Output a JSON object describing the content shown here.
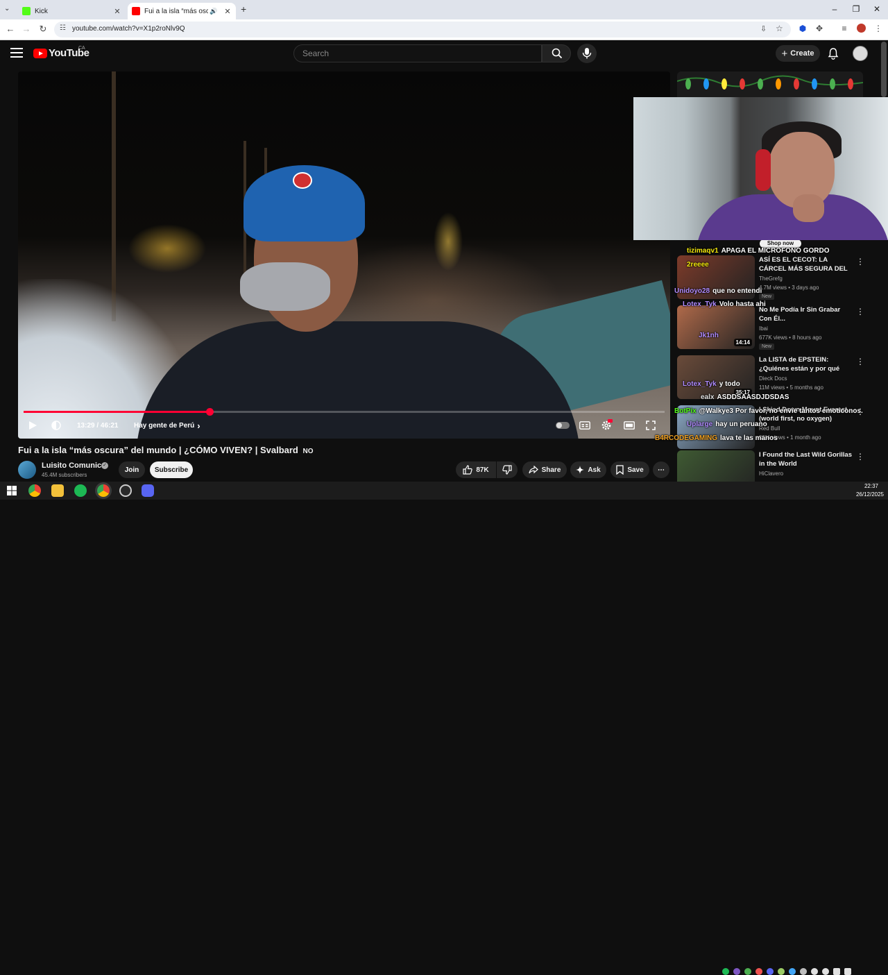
{
  "browser": {
    "tabs": [
      {
        "title": "Kick",
        "favicon_color": "#53fc18"
      },
      {
        "title": "Fui a la isla “más oscura” d",
        "favicon_color": "#ff0000"
      }
    ],
    "new_tab_label": "+",
    "url": "youtube.com/watch?v=X1p2roNlv9Q"
  },
  "youtube": {
    "logo_text": "YouTube",
    "country_code": "CA",
    "search_placeholder": "Search",
    "create_label": "Create"
  },
  "player": {
    "progress_fraction": 0.29,
    "time_current_total": "13:29 / 46:21",
    "chapter": "Hay gente de Perú",
    "chapter_chevron": "›"
  },
  "video": {
    "title": "Fui a la isla “más oscura” del mundo | ¿CÓMO VIVEN? | Svalbard",
    "title_flag": "NO",
    "channel": "Luisito Comunica",
    "subscribers": "45.4M subscribers",
    "join_label": "Join",
    "subscribe_label": "Subscribe",
    "likes": "87K",
    "share_label": "Share",
    "ask_label": "Ask",
    "save_label": "Save"
  },
  "sidebar": {
    "shop_now_label": "Shop now",
    "recommendations": [
      {
        "title": "ASÍ ES EL CECOT: LA CÁRCEL MÁS SEGURA DEL MUNDO",
        "channel": "TheGrefg",
        "meta": "4.7M views • 3 days ago",
        "badge": "New",
        "duration": "",
        "thumb": "#7d3b2a"
      },
      {
        "title": "No Me Podía Ir Sin Grabar Con Él...",
        "channel": "Ibai",
        "meta": "677K views • 8 hours ago",
        "badge": "New",
        "duration": "14:14",
        "thumb": "#b06a4a"
      },
      {
        "title": "La LISTA de EPSTEIN: ¿Quiénes están y por qué NADIE habla d...",
        "channel": "Dieck Docs",
        "meta": "11M views • 5 months ago",
        "badge": "",
        "duration": "35:17",
        "thumb": "#6a4b3a"
      },
      {
        "title": "I Skied Down Mount Everest (world first, no oxygen)",
        "channel": "Red Bull",
        "meta": "25M views • 1 month ago",
        "badge": "",
        "duration": "",
        "thumb": "#8aa7c4"
      },
      {
        "title": "I Found the Last Wild Gorillas in the World",
        "channel": "HiClavero",
        "meta": "",
        "badge": "",
        "duration": "",
        "thumb": "#3f5a33"
      }
    ]
  },
  "chat": [
    {
      "user": "tizimaqv1",
      "message": "APAGA EL MICROFONO GORDO",
      "color": "#f4e90b"
    },
    {
      "user": "2reeee",
      "message": "",
      "color": "#f4e90b"
    },
    {
      "user": "Unidoyo28",
      "message": "que no entendi",
      "color": "#b18cff"
    },
    {
      "user": "Lotex_Tyk",
      "message": "Volo hasta ahi",
      "color": "#b18cff"
    },
    {
      "user": "Jk1nh",
      "message": "",
      "color": "#b18cff"
    },
    {
      "user": "Lotex_Tyk",
      "message": "y todo",
      "color": "#b18cff"
    },
    {
      "user": "ealx",
      "message": "ASDDSAASDJDSDAS",
      "color": "#e0e0e0"
    },
    {
      "user": "BotPix",
      "message": "@Walkye3 Por favor, no envie tantos emoticonos.",
      "color": "#53fc18"
    },
    {
      "user": "Uplarge",
      "message": "hay un peruano",
      "color": "#b18cff"
    },
    {
      "user": "B4RCODEGAMING",
      "message": "lava te las manos",
      "color": "#f0a020"
    }
  ],
  "taskbar": {
    "time": "22:37",
    "date": "26/12/2025"
  }
}
